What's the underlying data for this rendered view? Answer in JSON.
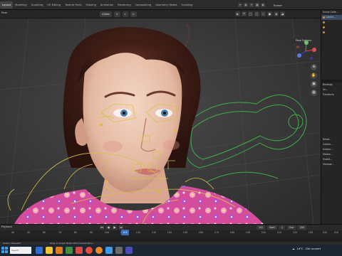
{
  "menubar": {
    "workspaces": [
      "Layout",
      "Modeling",
      "Sculpting",
      "UV Editing",
      "Texture Paint",
      "Shading",
      "Animation",
      "Rendering",
      "Compositing",
      "Geometry Nodes",
      "Scripting"
    ],
    "active_workspace": "Layout",
    "scene_label": "Scene"
  },
  "viewport_header": {
    "mode": "Pose",
    "orientation": "Global",
    "pose_options": "Pose Options"
  },
  "outliner": {
    "rows": [
      "Scene Colle...",
      "Collect...",
      "",
      "",
      "",
      "",
      ""
    ]
  },
  "properties": {
    "rows": [
      "Bindings",
      "Un...",
      "Transform",
      "",
      "",
      "",
      "",
      "",
      "",
      "",
      "",
      "Relati...",
      "Collect...",
      "Instanc...",
      "Motion...",
      "Visibili...",
      "Viewpor..."
    ]
  },
  "timeline": {
    "playback_label": "Playback",
    "current_frame": "102",
    "start_label": "Start",
    "start_value": "1",
    "end_label": "End",
    "end_value": "250",
    "ticks": [
      "40",
      "50",
      "60",
      "70",
      "80",
      "90",
      "100",
      "110",
      "120",
      "130",
      "140",
      "150",
      "160",
      "170",
      "180",
      "190",
      "200",
      "210",
      "220",
      "230",
      "240",
      "250"
    ]
  },
  "statusbar": {
    "left": "Select / Deselect",
    "mid": "Drag on Graph Node Shot Context Menu"
  },
  "taskbar": {
    "search_placeholder": "Search",
    "weather": "14°C",
    "weather_desc": "Ciel couvert",
    "time": "",
    "date": ""
  },
  "colors": {
    "accent": "#3a6ab8",
    "armature_yellow": "#d8c04a",
    "armature_green": "#3fae4a"
  }
}
